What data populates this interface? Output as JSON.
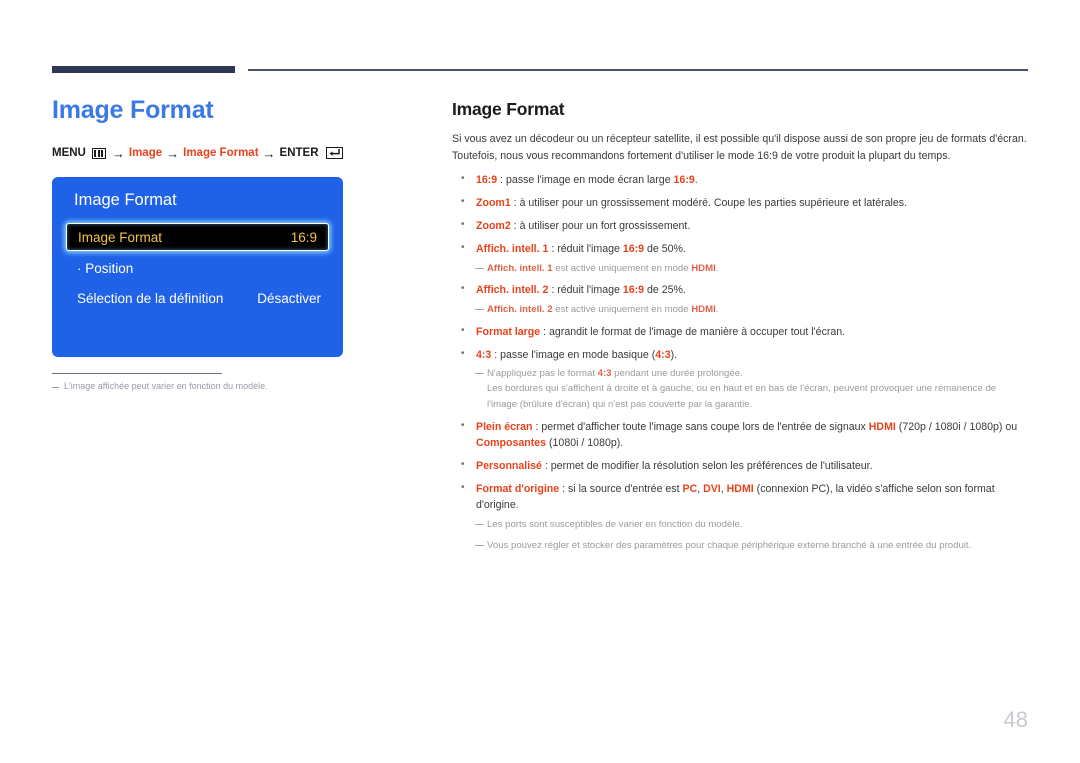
{
  "page": {
    "number": "48"
  },
  "left": {
    "title": "Image Format",
    "menu_path": {
      "menu_label": "MENU",
      "menu_icon": "menu-grid-icon",
      "arrow": "→",
      "step1": "Image",
      "step2": "Image Format",
      "enter_label": "ENTER",
      "enter_icon": "enter-return-icon"
    },
    "osd": {
      "title": "Image Format",
      "rows": [
        {
          "label": "Image Format",
          "value": "16:9",
          "selected": true
        },
        {
          "label": "· Position",
          "value": "",
          "selected": false
        },
        {
          "label": "Sélection de la définition",
          "value": "Désactiver",
          "selected": false
        }
      ]
    },
    "footnote": "L'image affichée peut varier en fonction du modèle."
  },
  "right": {
    "title": "Image Format",
    "intro": "Si vous avez un décodeur ou un récepteur satellite, il est possible qu'il dispose aussi de son propre jeu de formats d'écran. Toutefois, nous vous recommandons fortement d'utiliser le mode 16:9 de votre produit la plupart du temps.",
    "bullets": [
      {
        "term": "16:9",
        "text_before": " : passe l'image en mode écran large ",
        "emph": "16:9",
        "text_after": "."
      },
      {
        "term": "Zoom1",
        "text_before": " : à utiliser pour un grossissement modéré. Coupe les parties supérieure et latérales.",
        "emph": "",
        "text_after": ""
      },
      {
        "term": "Zoom2",
        "text_before": " : à utiliser pour un fort grossissement.",
        "emph": "",
        "text_after": ""
      },
      {
        "term": "Affich. intell. 1",
        "text_before": " : réduit l'image ",
        "emph": "16:9",
        "text_after": " de 50%."
      },
      {
        "term": "Affich. intell. 2",
        "text_before": " : réduit l'image ",
        "emph": "16:9",
        "text_after": " de 25%."
      },
      {
        "term": "Format large",
        "text_before": " : agrandit le format de l'image de manière à occuper tout l'écran.",
        "emph": "",
        "text_after": ""
      },
      {
        "term": "4:3",
        "text_before": " : passe l'image en mode basique (",
        "emph": "4:3",
        "text_after": ")."
      },
      {
        "term": "Plein écran",
        "text_before": " : permet d'afficher toute l'image sans coupe lors de l'entrée de signaux ",
        "emph": "HDMI",
        "text_after": " (720p / 1080i / 1080p) ou ",
        "emph2": "Composantes",
        "text_after2": " (1080i / 1080p)."
      },
      {
        "term": "Personnalisé",
        "text_before": " : permet de modifier la résolution selon les préférences de l'utilisateur.",
        "emph": "",
        "text_after": ""
      },
      {
        "term": "Format d'origine",
        "text_before": " : si la source d'entrée est ",
        "emph": "PC",
        "text_mid1": ", ",
        "emph2": "DVI",
        "text_mid2": ", ",
        "emph3": "HDMI",
        "text_after": " (connexion PC), la vidéo s'affiche selon son format d'origine."
      }
    ],
    "notes": {
      "smart1_hdmi_term": "Affich. intell. 1",
      "smart1_hdmi_text": " est activé uniquement en mode ",
      "smart1_hdmi_emph": "HDMI",
      "smart1_hdmi_end": ".",
      "smart2_hdmi_term": "Affich. intell. 2",
      "smart2_hdmi_text": " est activé uniquement en mode ",
      "smart2_hdmi_emph": "HDMI",
      "smart2_hdmi_end": ".",
      "ratio43_before": "N'appliquez pas le format ",
      "ratio43_emph": "4:3",
      "ratio43_after": " pendant une durée prolongée.",
      "ratio43_cont": "Les bordures qui s'affichent à droite et à gauche, ou en haut et en bas de l'écran, peuvent provoquer une rémanence de l'image (brûlure d'écran) qui n'est pas couverte par la garantie.",
      "ports_note": "Les ports sont susceptibles de varier en fonction du modèle.",
      "store_note": "Vous pouvez régler et stocker des paramètres pour chaque périphérique externe branché à une entrée du produit."
    }
  },
  "colors": {
    "accent_blue": "#3b7ae4",
    "osd_blue": "#1f62e8",
    "highlight_amber": "#f2c14a",
    "term_red": "#e8421c",
    "rule_navy": "#2e3656",
    "page_number_gray": "#c9c9cf"
  }
}
